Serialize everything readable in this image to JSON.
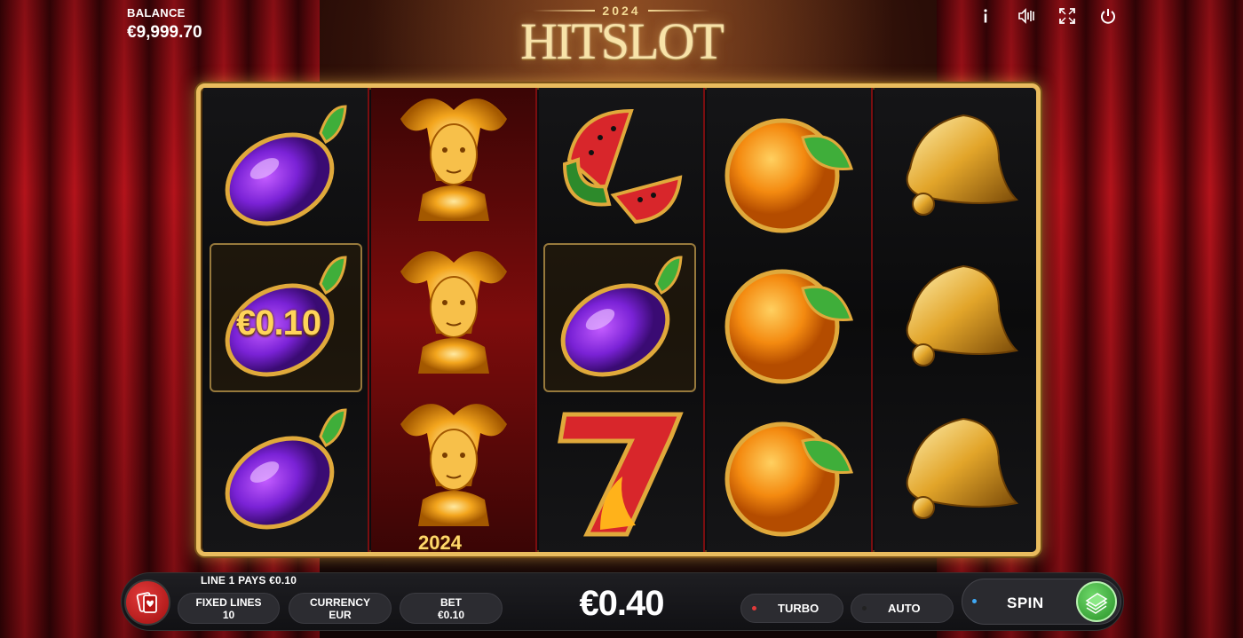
{
  "balance": {
    "label": "BALANCE",
    "value": "€9,999.70"
  },
  "logo": {
    "year": "2024",
    "name": "HITSLOT"
  },
  "top_icons": [
    "info-icon",
    "sound-icon",
    "fullscreen-icon",
    "power-icon"
  ],
  "reels": [
    [
      "plum",
      "plum",
      "plum"
    ],
    [
      "jester",
      "jester",
      "jester"
    ],
    [
      "watermelon",
      "plum",
      "seven"
    ],
    [
      "orange",
      "orange",
      "orange"
    ],
    [
      "bell",
      "bell",
      "bell"
    ]
  ],
  "win": {
    "amount_label": "€0.10",
    "jester_year": "2024"
  },
  "bottom": {
    "line_pays": "LINE 1 PAYS €0.10",
    "fixed_lines_label": "FIXED LINES",
    "fixed_lines_value": "10",
    "currency_label": "CURRENCY",
    "currency_value": "EUR",
    "bet_label": "BET",
    "bet_value": "€0.10",
    "total_bet": "€0.40",
    "turbo_label": "TURBO",
    "auto_label": "AUTO",
    "spin_label": "SPIN"
  },
  "colors": {
    "gold": "#e9bc5e",
    "turbo_dot": "#e23a3a",
    "auto_dot": "#222222",
    "spin_dot": "#3fa9f5",
    "spin_button": "#3fbf3a"
  }
}
